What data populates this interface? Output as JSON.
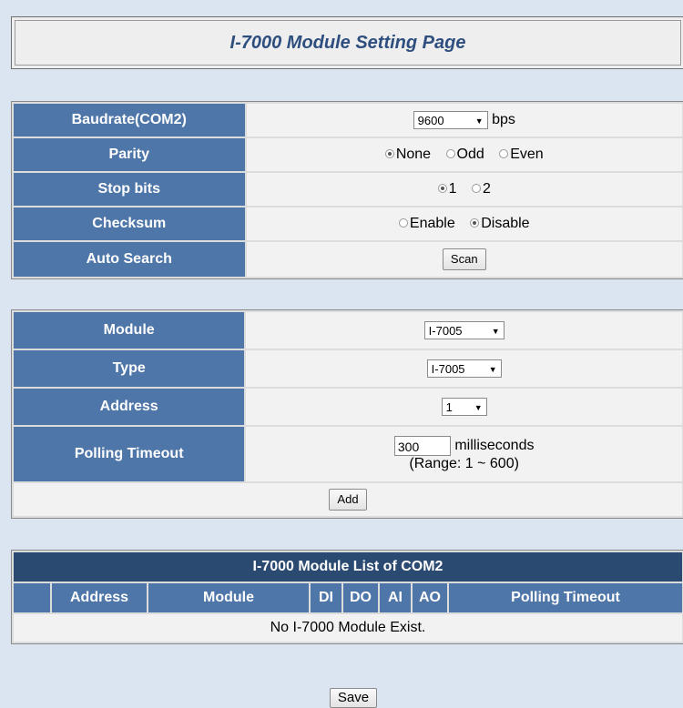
{
  "page": {
    "title": "I-7000 Module Setting Page"
  },
  "com_settings": {
    "baudrate": {
      "label": "Baudrate(COM2)",
      "value": "9600",
      "unit": "bps"
    },
    "parity": {
      "label": "Parity",
      "options": [
        "None",
        "Odd",
        "Even"
      ],
      "selected": "None"
    },
    "stop_bits": {
      "label": "Stop bits",
      "options": [
        "1",
        "2"
      ],
      "selected": "1"
    },
    "checksum": {
      "label": "Checksum",
      "options": [
        "Enable",
        "Disable"
      ],
      "selected": "Disable"
    },
    "auto_search": {
      "label": "Auto Search",
      "button": "Scan"
    }
  },
  "module_settings": {
    "module": {
      "label": "Module",
      "value": "I-7005"
    },
    "type": {
      "label": "Type",
      "value": "I-7005"
    },
    "address": {
      "label": "Address",
      "value": "1"
    },
    "polling_timeout": {
      "label": "Polling Timeout",
      "value": "300",
      "unit": "milliseconds",
      "range": "(Range: 1 ~ 600)"
    },
    "add_button": "Add"
  },
  "module_list": {
    "title": "I-7000 Module List of COM2",
    "columns": [
      "",
      "Address",
      "Module",
      "DI",
      "DO",
      "AI",
      "AO",
      "Polling Timeout"
    ],
    "empty_message": "No I-7000 Module Exist."
  },
  "save_button": "Save"
}
